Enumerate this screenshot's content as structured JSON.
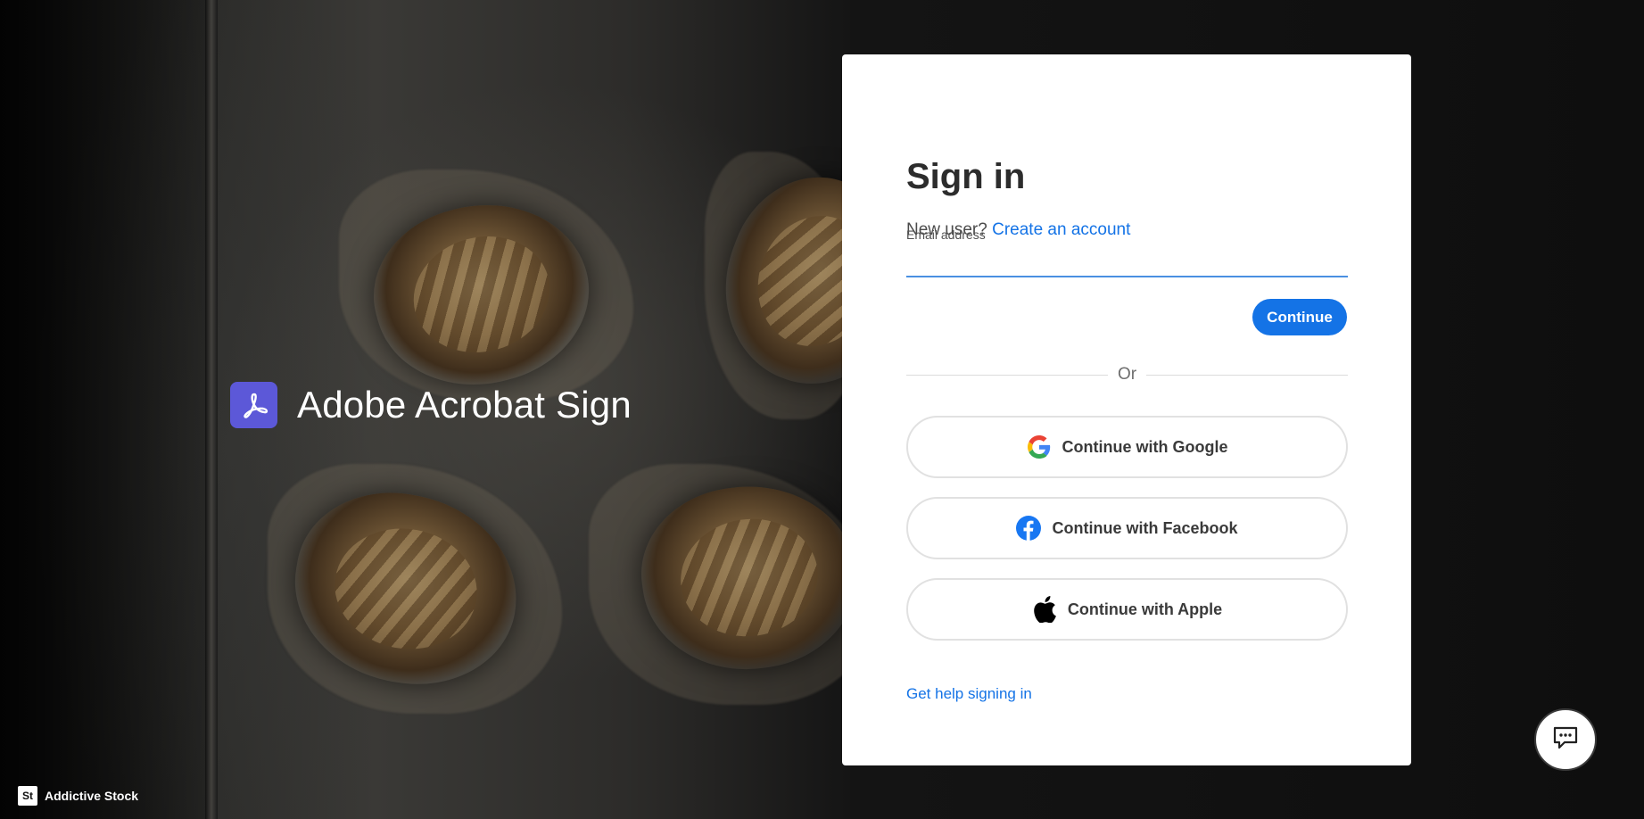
{
  "brand": {
    "name": "Adobe Acrobat Sign",
    "logo_color": "#5c58d8"
  },
  "signin": {
    "title": "Sign in",
    "new_user_text": "New user?",
    "create_account_link": "Create an account",
    "email_label": "Email address",
    "email_value": "",
    "continue_label": "Continue",
    "or_text": "Or",
    "social": [
      {
        "label": "Continue with Google",
        "icon": "google-icon"
      },
      {
        "label": "Continue with Facebook",
        "icon": "facebook-icon"
      },
      {
        "label": "Continue with Apple",
        "icon": "apple-icon"
      }
    ],
    "help_link": "Get help signing in"
  },
  "footer": {
    "credit_badge": "St",
    "credit_text": "Addictive Stock"
  },
  "chat": {
    "icon": "chat-icon"
  },
  "colors": {
    "accent": "#1473e6",
    "card_bg": "#ffffff",
    "input_underline": "#4a90e2"
  }
}
